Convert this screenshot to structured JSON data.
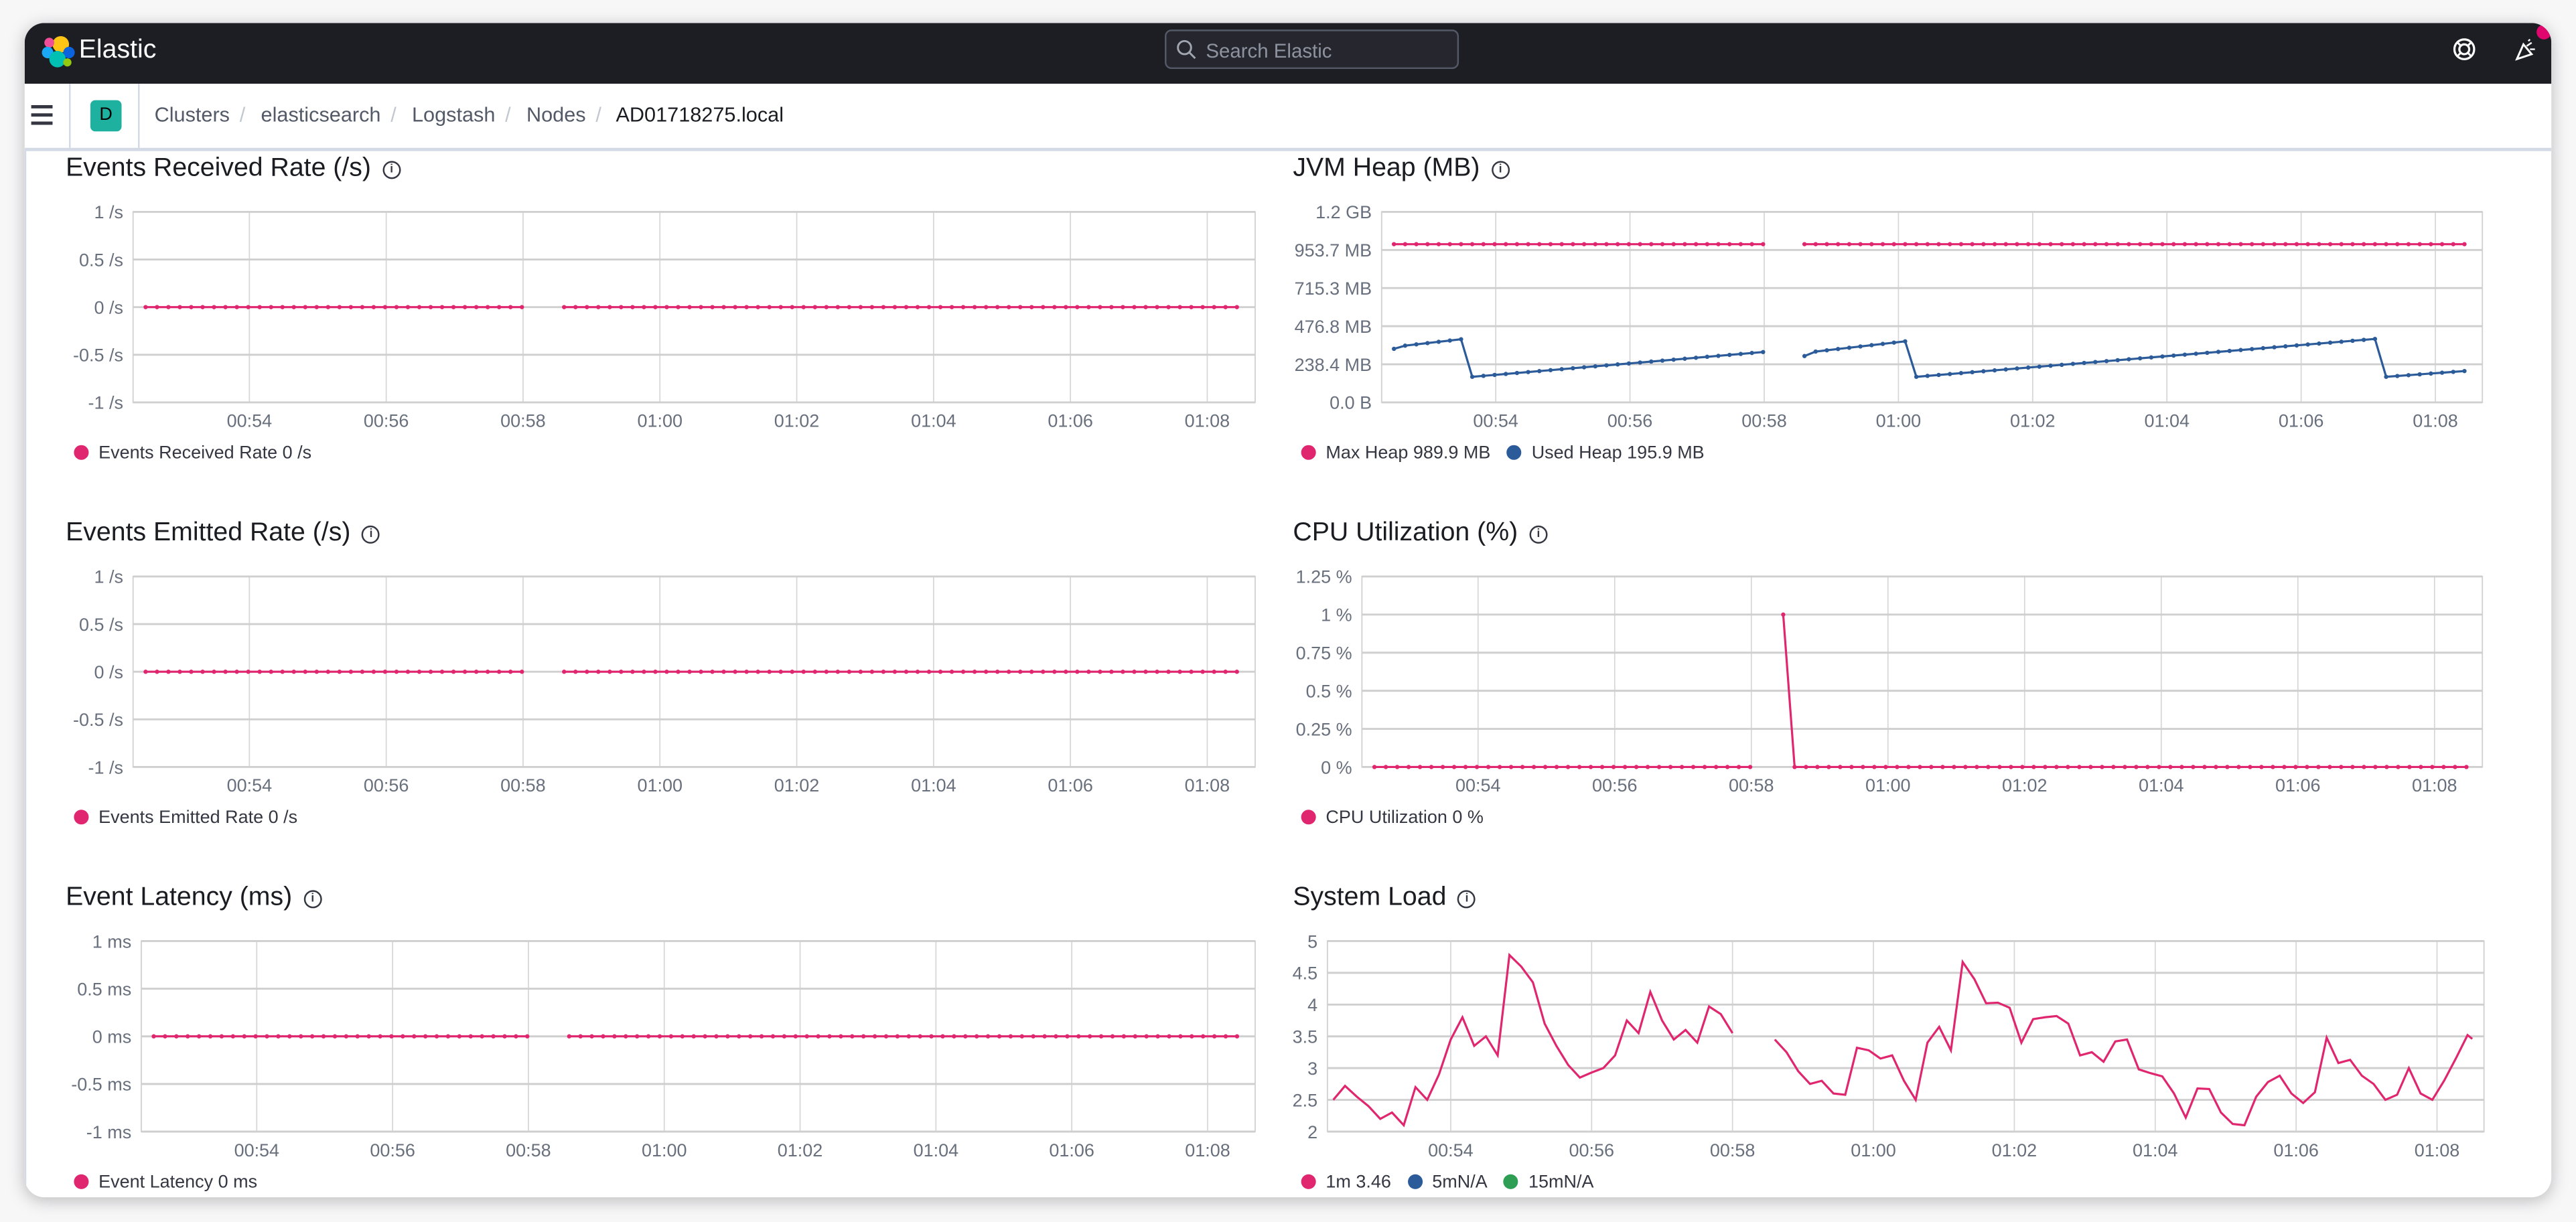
{
  "header": {
    "app_name": "Elastic",
    "search_placeholder": "Search Elastic",
    "icons": [
      "elastic-logo",
      "search-icon",
      "help-icon",
      "newsfeed-icon"
    ]
  },
  "breadcrumb": {
    "space_initial": "D",
    "items": [
      "Clusters",
      "elasticsearch",
      "Logstash",
      "Nodes",
      "AD01718275.local"
    ]
  },
  "colors": {
    "pink": "#e0266f",
    "blue": "#2c5b9a",
    "green": "#2f9e55",
    "space_badge": "#1fb1a0"
  },
  "chart_data": [
    {
      "type": "line",
      "title": "Events Received Rate (/s)",
      "xlim": [
        "00:52:18",
        "01:08:42"
      ],
      "ylim": [
        -1,
        1
      ],
      "yticks": [
        {
          "value": 1,
          "label": "1 /s"
        },
        {
          "value": 0.5,
          "label": "0.5 /s"
        },
        {
          "value": 0,
          "label": "0 /s"
        },
        {
          "value": -0.5,
          "label": "-0.5 /s"
        },
        {
          "value": -1,
          "label": "-1 /s"
        }
      ],
      "xticks": [
        "00:54",
        "00:56",
        "00:58",
        "01:00",
        "01:02",
        "01:04",
        "01:06",
        "01:08"
      ],
      "series": [
        {
          "name": "Events Received Rate",
          "legend": "Events Received Rate 0 /s",
          "color": "#e0266f",
          "markers": true,
          "segments": [
            [
              [
                "00:52:29",
                0
              ],
              [
                "00:57:59",
                0
              ]
            ],
            [
              [
                "00:58:36",
                0
              ],
              [
                "01:08:26",
                0
              ]
            ]
          ]
        }
      ]
    },
    {
      "type": "line",
      "title": "JVM Heap (MB)",
      "xlim": [
        "00:52:18",
        "01:08:42"
      ],
      "ylim": [
        0,
        1192.1
      ],
      "yticks": [
        {
          "value": 1192.1,
          "label": "1.2 GB"
        },
        {
          "value": 953.7,
          "label": "953.7 MB"
        },
        {
          "value": 715.3,
          "label": "715.3 MB"
        },
        {
          "value": 476.8,
          "label": "476.8 MB"
        },
        {
          "value": 238.4,
          "label": "238.4 MB"
        },
        {
          "value": 0,
          "label": "0.0 B"
        }
      ],
      "xticks": [
        "00:54",
        "00:56",
        "00:58",
        "01:00",
        "01:02",
        "01:04",
        "01:06",
        "01:08"
      ],
      "series": [
        {
          "name": "Max Heap",
          "legend": "Max Heap 989.9 MB",
          "color": "#e0266f",
          "markers": true,
          "segments": [
            [
              [
                "00:52:29",
                989.9
              ],
              [
                "00:57:59",
                989.9
              ]
            ],
            [
              [
                "00:58:36",
                989.9
              ],
              [
                "01:08:26",
                989.9
              ]
            ]
          ]
        },
        {
          "name": "Used Heap",
          "legend": "Used Heap 195.9 MB",
          "color": "#2c5b9a",
          "markers": true,
          "segments": [
            [
              [
                "00:52:29",
                335
              ],
              [
                "00:52:39",
                355
              ],
              [
                "00:53:29",
                395
              ],
              [
                "00:53:39",
                160
              ],
              [
                "00:57:59",
                315
              ]
            ],
            [
              [
                "00:58:36",
                290
              ],
              [
                "00:58:46",
                318
              ],
              [
                "01:00:06",
                382
              ],
              [
                "01:00:16",
                160
              ],
              [
                "01:07:06",
                397
              ],
              [
                "01:07:16",
                160
              ],
              [
                "01:08:26",
                196
              ]
            ]
          ]
        }
      ]
    },
    {
      "type": "line",
      "title": "Events Emitted Rate (/s)",
      "xlim": [
        "00:52:18",
        "01:08:42"
      ],
      "ylim": [
        -1,
        1
      ],
      "yticks": [
        {
          "value": 1,
          "label": "1 /s"
        },
        {
          "value": 0.5,
          "label": "0.5 /s"
        },
        {
          "value": 0,
          "label": "0 /s"
        },
        {
          "value": -0.5,
          "label": "-0.5 /s"
        },
        {
          "value": -1,
          "label": "-1 /s"
        }
      ],
      "xticks": [
        "00:54",
        "00:56",
        "00:58",
        "01:00",
        "01:02",
        "01:04",
        "01:06",
        "01:08"
      ],
      "series": [
        {
          "name": "Events Emitted Rate",
          "legend": "Events Emitted Rate 0 /s",
          "color": "#e0266f",
          "markers": true,
          "segments": [
            [
              [
                "00:52:29",
                0
              ],
              [
                "00:57:59",
                0
              ]
            ],
            [
              [
                "00:58:36",
                0
              ],
              [
                "01:08:26",
                0
              ]
            ]
          ]
        }
      ]
    },
    {
      "type": "line",
      "title": "CPU Utilization (%)",
      "xlim": [
        "00:52:18",
        "01:08:42"
      ],
      "ylim": [
        0,
        1.25
      ],
      "yticks": [
        {
          "value": 1.25,
          "label": "1.25 %"
        },
        {
          "value": 1,
          "label": "1 %"
        },
        {
          "value": 0.75,
          "label": "0.75 %"
        },
        {
          "value": 0.5,
          "label": "0.5 %"
        },
        {
          "value": 0.25,
          "label": "0.25 %"
        },
        {
          "value": 0,
          "label": "0 %"
        }
      ],
      "xticks": [
        "00:54",
        "00:56",
        "00:58",
        "01:00",
        "01:02",
        "01:04",
        "01:06",
        "01:08"
      ],
      "series": [
        {
          "name": "CPU Utilization",
          "legend": "CPU Utilization 0 %",
          "color": "#e0266f",
          "markers": true,
          "segments": [
            [
              [
                "00:52:29",
                0
              ],
              [
                "00:57:59",
                0
              ]
            ],
            [
              [
                "00:58:28",
                1
              ],
              [
                "00:58:38",
                0
              ],
              [
                "01:08:28",
                0
              ]
            ]
          ]
        }
      ]
    },
    {
      "type": "line",
      "title": "Event Latency (ms)",
      "xlim": [
        "00:52:18",
        "01:08:42"
      ],
      "ylim": [
        -1,
        1
      ],
      "yticks": [
        {
          "value": 1,
          "label": "1 ms"
        },
        {
          "value": 0.5,
          "label": "0.5 ms"
        },
        {
          "value": 0,
          "label": "0 ms"
        },
        {
          "value": -0.5,
          "label": "-0.5 ms"
        },
        {
          "value": -1,
          "label": "-1 ms"
        }
      ],
      "xticks": [
        "00:54",
        "00:56",
        "00:58",
        "01:00",
        "01:02",
        "01:04",
        "01:06",
        "01:08"
      ],
      "series": [
        {
          "name": "Event Latency",
          "legend": "Event Latency 0 ms",
          "color": "#e0266f",
          "markers": true,
          "segments": [
            [
              [
                "00:52:29",
                0
              ],
              [
                "00:57:59",
                0
              ]
            ],
            [
              [
                "00:58:36",
                0
              ],
              [
                "01:08:26",
                0
              ]
            ]
          ]
        }
      ]
    },
    {
      "type": "line",
      "title": "System Load",
      "xlim": [
        "00:52:15",
        "01:08:40"
      ],
      "ylim": [
        2,
        5
      ],
      "yticks": [
        {
          "value": 5,
          "label": "5"
        },
        {
          "value": 4.5,
          "label": "4.5"
        },
        {
          "value": 4,
          "label": "4"
        },
        {
          "value": 3.5,
          "label": "3.5"
        },
        {
          "value": 3,
          "label": "3"
        },
        {
          "value": 2.5,
          "label": "2.5"
        },
        {
          "value": 2,
          "label": "2"
        }
      ],
      "xticks": [
        "00:54",
        "00:56",
        "00:58",
        "01:00",
        "01:02",
        "01:04",
        "01:06",
        "01:08"
      ],
      "series": [
        {
          "name": "1m",
          "legend": "1m 3.46",
          "color": "#e0266f",
          "markers": false,
          "segments": [
            [
              [
                "00:52:20",
                2.5
              ],
              [
                "00:52:30",
                2.72
              ],
              [
                "00:52:40",
                2.55
              ],
              [
                "00:52:50",
                2.4
              ],
              [
                "00:53:00",
                2.2
              ],
              [
                "00:53:10",
                2.3
              ],
              [
                "00:53:20",
                2.1
              ],
              [
                "00:53:30",
                2.7
              ],
              [
                "00:53:40",
                2.5
              ],
              [
                "00:53:50",
                2.9
              ],
              [
                "00:54:00",
                3.45
              ],
              [
                "00:54:10",
                3.8
              ],
              [
                "00:54:20",
                3.35
              ],
              [
                "00:54:30",
                3.5
              ],
              [
                "00:54:40",
                3.2
              ],
              [
                "00:54:50",
                4.78
              ],
              [
                "00:55:00",
                4.6
              ],
              [
                "00:55:10",
                4.35
              ],
              [
                "00:55:20",
                3.7
              ],
              [
                "00:55:30",
                3.35
              ],
              [
                "00:55:40",
                3.05
              ],
              [
                "00:55:50",
                2.85
              ],
              [
                "00:56:00",
                2.93
              ],
              [
                "00:56:10",
                3.0
              ],
              [
                "00:56:20",
                3.2
              ],
              [
                "00:56:30",
                3.75
              ],
              [
                "00:56:40",
                3.55
              ],
              [
                "00:56:50",
                4.2
              ],
              [
                "00:57:00",
                3.75
              ],
              [
                "00:57:10",
                3.45
              ],
              [
                "00:57:20",
                3.6
              ],
              [
                "00:57:30",
                3.4
              ],
              [
                "00:57:40",
                3.97
              ],
              [
                "00:57:50",
                3.85
              ],
              [
                "00:58:00",
                3.55
              ]
            ],
            [
              [
                "00:58:36",
                3.45
              ],
              [
                "00:58:46",
                3.25
              ],
              [
                "00:58:56",
                2.95
              ],
              [
                "00:59:06",
                2.75
              ],
              [
                "00:59:16",
                2.8
              ],
              [
                "00:59:26",
                2.6
              ],
              [
                "00:59:36",
                2.58
              ],
              [
                "00:59:46",
                3.32
              ],
              [
                "00:59:56",
                3.28
              ],
              [
                "01:00:06",
                3.15
              ],
              [
                "01:00:16",
                3.2
              ],
              [
                "01:00:26",
                2.8
              ],
              [
                "01:00:36",
                2.5
              ],
              [
                "01:00:46",
                3.4
              ],
              [
                "01:00:56",
                3.65
              ],
              [
                "01:01:06",
                3.28
              ],
              [
                "01:01:16",
                4.67
              ],
              [
                "01:01:26",
                4.4
              ],
              [
                "01:01:36",
                4.02
              ],
              [
                "01:01:46",
                4.03
              ],
              [
                "01:01:56",
                3.95
              ],
              [
                "01:02:06",
                3.4
              ],
              [
                "01:02:16",
                3.77
              ],
              [
                "01:02:26",
                3.8
              ],
              [
                "01:02:36",
                3.82
              ],
              [
                "01:02:46",
                3.7
              ],
              [
                "01:02:56",
                3.2
              ],
              [
                "01:03:06",
                3.25
              ],
              [
                "01:03:16",
                3.1
              ],
              [
                "01:03:26",
                3.42
              ],
              [
                "01:03:36",
                3.45
              ],
              [
                "01:03:46",
                2.98
              ],
              [
                "01:03:56",
                2.92
              ],
              [
                "01:04:06",
                2.87
              ],
              [
                "01:04:16",
                2.6
              ],
              [
                "01:04:26",
                2.22
              ],
              [
                "01:04:36",
                2.68
              ],
              [
                "01:04:46",
                2.67
              ],
              [
                "01:04:56",
                2.3
              ],
              [
                "01:05:06",
                2.12
              ],
              [
                "01:05:16",
                2.1
              ],
              [
                "01:05:26",
                2.55
              ],
              [
                "01:05:36",
                2.78
              ],
              [
                "01:05:46",
                2.88
              ],
              [
                "01:05:56",
                2.6
              ],
              [
                "01:06:06",
                2.45
              ],
              [
                "01:06:16",
                2.62
              ],
              [
                "01:06:26",
                3.48
              ],
              [
                "01:06:36",
                3.08
              ],
              [
                "01:06:46",
                3.13
              ],
              [
                "01:06:56",
                2.88
              ],
              [
                "01:07:06",
                2.75
              ],
              [
                "01:07:16",
                2.5
              ],
              [
                "01:07:26",
                2.58
              ],
              [
                "01:07:36",
                3.0
              ],
              [
                "01:07:46",
                2.6
              ],
              [
                "01:07:56",
                2.5
              ],
              [
                "01:08:06",
                2.8
              ],
              [
                "01:08:16",
                3.15
              ],
              [
                "01:08:26",
                3.52
              ],
              [
                "01:08:30",
                3.46
              ]
            ]
          ]
        },
        {
          "name": "5m",
          "legend": "5mN/A",
          "color": "#2c5b9a",
          "markers": false,
          "segments": []
        },
        {
          "name": "15m",
          "legend": "15mN/A",
          "color": "#2f9e55",
          "markers": false,
          "segments": []
        }
      ]
    }
  ]
}
